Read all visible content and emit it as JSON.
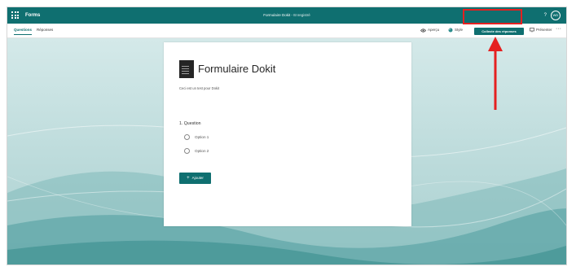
{
  "app": {
    "name": "Forms"
  },
  "header": {
    "doc_title": "Formulaire Dokit",
    "separator": "-",
    "status": "Enregistré",
    "help": "?",
    "avatar_initials": "WD"
  },
  "tabs": [
    {
      "label": "Questions",
      "active": true
    },
    {
      "label": "Réponses",
      "active": false
    }
  ],
  "toolbar": {
    "preview_label": "Aperçu",
    "style_label": "Style",
    "collect_label": "Collecte des réponses",
    "present_label": "Présenter",
    "more": "···"
  },
  "form": {
    "title": "Formulaire Dokit",
    "description": "Ceci est un test pour Dokit",
    "question": "1. Question",
    "options": [
      "Option 1",
      "Option 2"
    ],
    "add_label": "Ajouter",
    "add_icon": "+"
  },
  "colors": {
    "brand": "#0f6f70",
    "annotation": "#e52020"
  },
  "icons": [
    "waffle-icon",
    "eye-icon",
    "palette-icon",
    "present-icon",
    "more-icon",
    "plus-icon",
    "arrow-up-icon"
  ]
}
